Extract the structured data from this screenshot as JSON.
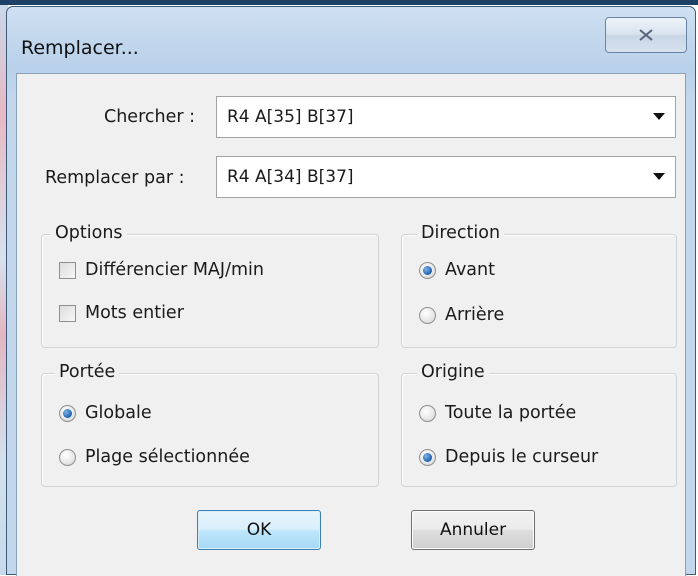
{
  "dialog": {
    "title": "Remplacer..."
  },
  "search": {
    "label": "Chercher :",
    "value": "R4 A[35] B[37]"
  },
  "replace": {
    "label": "Remplacer par :",
    "value": "R4 A[34] B[37]"
  },
  "options": {
    "legend": "Options",
    "items": [
      {
        "label": "Différencier MAJ/min",
        "checked": false
      },
      {
        "label": "Mots entier",
        "checked": false
      }
    ]
  },
  "direction": {
    "legend": "Direction",
    "items": [
      {
        "label": "Avant",
        "selected": true
      },
      {
        "label": "Arrière",
        "selected": false
      }
    ]
  },
  "scope": {
    "legend": "Portée",
    "items": [
      {
        "label": "Globale",
        "selected": true
      },
      {
        "label": "Plage sélectionnée",
        "selected": false
      }
    ]
  },
  "origin": {
    "legend": "Origine",
    "items": [
      {
        "label": "Toute la portée",
        "selected": false
      },
      {
        "label": "Depuis le curseur",
        "selected": true
      }
    ]
  },
  "buttons": {
    "ok": "OK",
    "cancel": "Annuler"
  },
  "icons": {
    "close": "close-icon",
    "dropdown": "chevron-down-icon"
  }
}
